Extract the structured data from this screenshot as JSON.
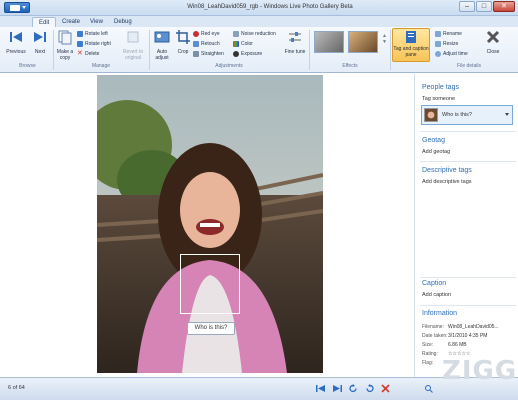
{
  "window": {
    "title": "Win08_LeahDavid059_rgb - Windows Live Photo Gallery Beta",
    "controls": {
      "minimize": "–",
      "maximize": "□",
      "close": "✕"
    }
  },
  "tabs": [
    "Edit",
    "Create",
    "View",
    "Debug"
  ],
  "ribbon": {
    "browse": {
      "previous": "Previous",
      "next": "Next",
      "label": "Browse"
    },
    "manage": {
      "make_copy": "Make a copy",
      "rotate_left": "Rotate left",
      "rotate_right": "Rotate right",
      "delete": "Delete",
      "revert": "Revert to original",
      "label": "Manage"
    },
    "adjustments": {
      "auto_adjust": "Auto adjust",
      "crop": "Crop",
      "red_eye": "Red eye",
      "retouch": "Retouch",
      "straighten": "Straighten",
      "noise_reduction": "Noise reduction",
      "color": "Color",
      "exposure": "Exposure",
      "fine_tune": "Fine tune",
      "label": "Adjustments"
    },
    "effects": {
      "label": "Effects"
    },
    "tag_caption": "Tag and caption pane",
    "file_details": {
      "rename": "Rename",
      "resize": "Resize",
      "adjust_time": "Adjust time",
      "close": "Close",
      "label": "File details"
    }
  },
  "photo": {
    "face_prompt": "Who is this?"
  },
  "pane": {
    "people_tags": {
      "heading": "People tags",
      "tag_someone": "Tag someone",
      "who_placeholder": "Who is this?"
    },
    "geotag": {
      "heading": "Geotag",
      "add": "Add geotag"
    },
    "descriptive_tags": {
      "heading": "Descriptive tags",
      "add": "Add descriptive tags"
    },
    "caption": {
      "heading": "Caption",
      "add": "Add caption"
    },
    "information": {
      "heading": "Information",
      "rows": [
        {
          "k": "Filename:",
          "v": "Win08_LeahDavid05..."
        },
        {
          "k": "Date taken:",
          "v": "3/1/2010 4:35 PM"
        },
        {
          "k": "Size:",
          "v": "6.86 MB"
        },
        {
          "k": "Rating:",
          "v": "☆☆☆☆☆"
        },
        {
          "k": "Flag:",
          "v": ""
        }
      ]
    }
  },
  "statusbar": {
    "counter": "6 of 64"
  },
  "watermark": "ZIGG"
}
